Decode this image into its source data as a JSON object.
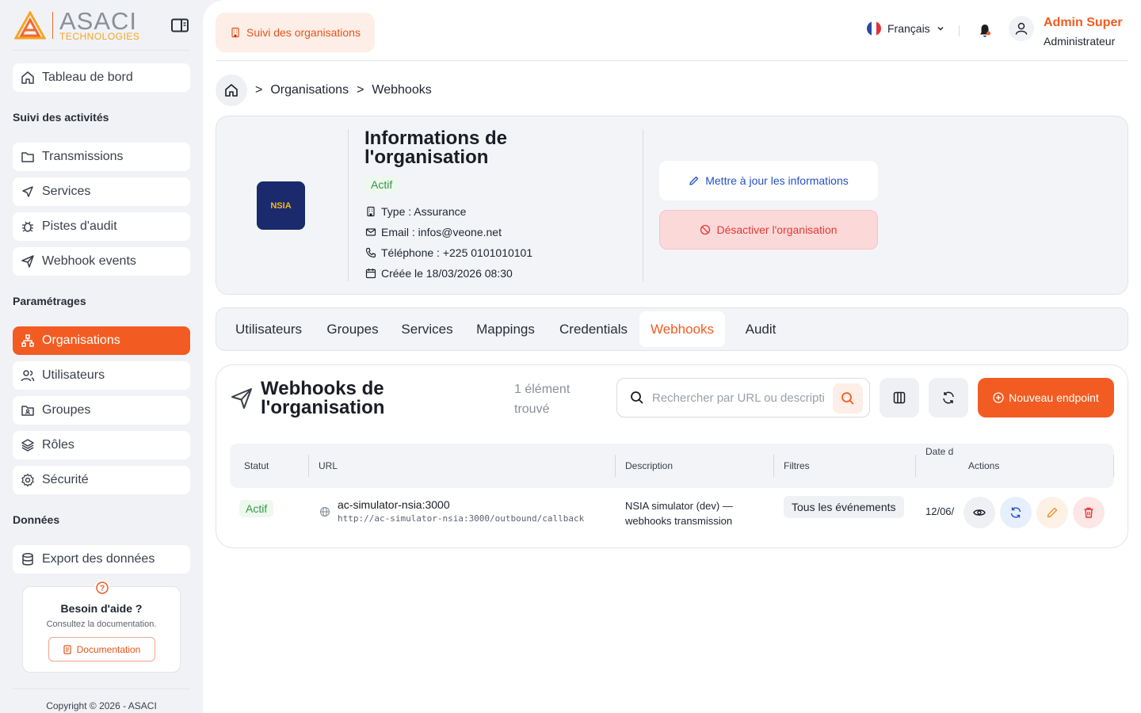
{
  "brand": {
    "name": "ASACI",
    "subtitle": "TECHNOLOGIES"
  },
  "sidebar": {
    "dashboard": "Tableau de bord",
    "section_activity": "Suivi des activités",
    "activity_items": [
      "Transmissions",
      "Services",
      "Pistes d'audit",
      "Webhook events"
    ],
    "section_settings": "Paramétrages",
    "settings_items": [
      "Organisations",
      "Utilisateurs",
      "Groupes",
      "Rôles",
      "Sécurité"
    ],
    "section_data": "Données",
    "data_items": [
      "Export des données"
    ],
    "help": {
      "title": "Besoin d'aide ?",
      "subtitle": "Consultez la documentation.",
      "button": "Documentation"
    },
    "footer": "Copyright © 2026 - ASACI"
  },
  "topbar": {
    "chip": "Suivi des organisations",
    "language": "Français",
    "user_name": "Admin Super",
    "user_role": "Administrateur"
  },
  "breadcrumb": {
    "parent": "Organisations",
    "separator": ">",
    "current": "Webhooks"
  },
  "organization": {
    "title": "Informations de l'organisation",
    "logo_text": "NSIA",
    "status": "Actif",
    "type": "Type : Assurance",
    "email": "Email : infos@veone.net",
    "phone": "Téléphone : +225 0101010101",
    "created": "Créée le 18/03/2026 08:30",
    "update_button": "Mettre à jour les informations",
    "deactivate_button": "Désactiver l'organisation"
  },
  "tabs": {
    "active": "Webhooks",
    "items": [
      "Utilisateurs",
      "Groupes",
      "Services",
      "Mappings",
      "Credentials",
      "Webhooks",
      "Audit"
    ]
  },
  "webhooks": {
    "title": "Webhooks de l'organisation",
    "count": "1 élément trouvé",
    "search_placeholder": "Rechercher par URL ou description",
    "new_button": "Nouveau endpoint",
    "columns": [
      "Statut",
      "URL",
      "Description",
      "Filtres",
      "Date d",
      "Actions"
    ],
    "rows": [
      {
        "status": "Actif",
        "url_name": "ac-simulator-nsia:3000",
        "url_full": "http://ac-simulator-nsia:3000/outbound/callback",
        "description_line1": "NSIA simulator (dev) —",
        "description_line2": "webhooks transmission",
        "filters": "Tous les événements",
        "date": "12/06/"
      }
    ]
  },
  "colors": {
    "accent": "#f25c22",
    "success": "#2f9b46",
    "danger": "#e53935",
    "link": "#2450c8"
  }
}
